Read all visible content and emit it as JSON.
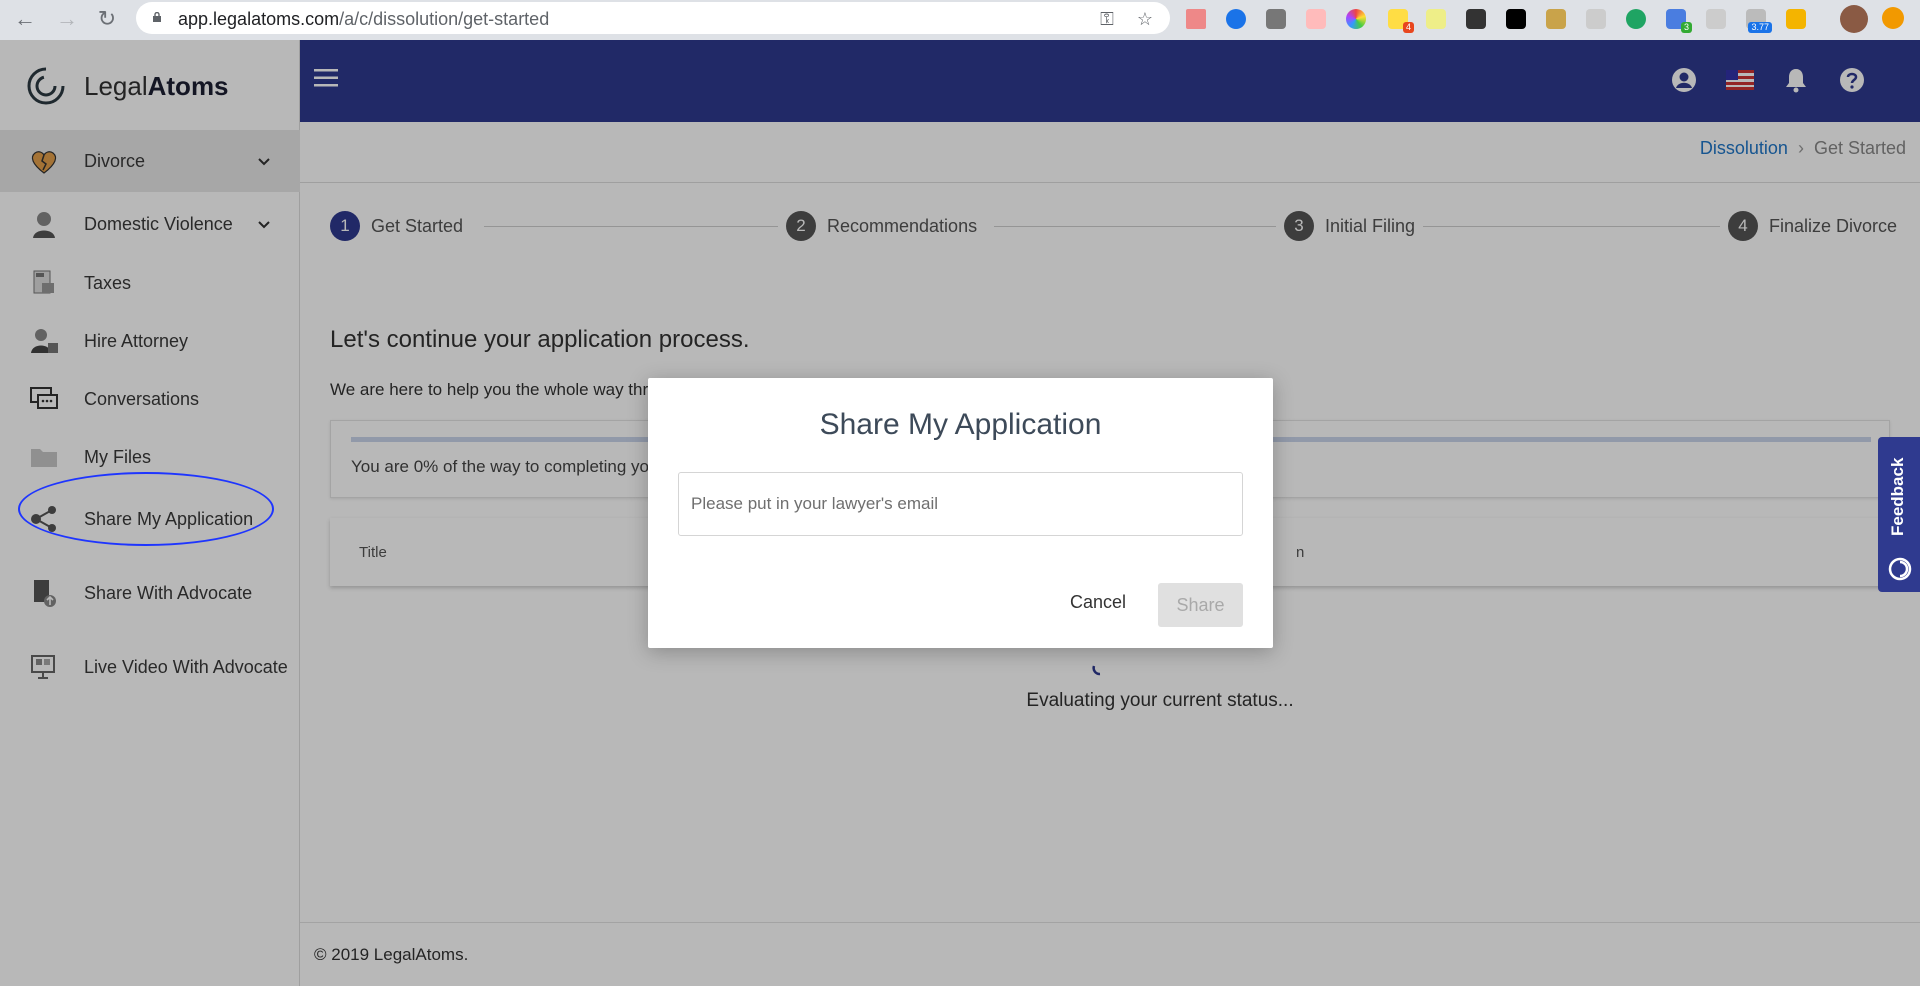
{
  "browser": {
    "url_host": "app.legalatoms.com",
    "url_path": "/a/c/dissolution/get-started",
    "extension_badges": [
      "4",
      "3",
      "3.77"
    ]
  },
  "logo": {
    "light": "Legal",
    "bold": "Atoms"
  },
  "sidebar": {
    "items": [
      {
        "label": "Divorce"
      },
      {
        "label": "Domestic Violence"
      },
      {
        "label": "Taxes"
      },
      {
        "label": "Hire Attorney"
      },
      {
        "label": "Conversations"
      },
      {
        "label": "My Files"
      },
      {
        "label": "Share My Application"
      },
      {
        "label": "Share With Advocate"
      },
      {
        "label": "Live Video With Advocate"
      }
    ]
  },
  "breadcrumb": {
    "parent": "Dissolution",
    "separator": "›",
    "current": "Get Started"
  },
  "steps": [
    {
      "num": "1",
      "label": "Get Started"
    },
    {
      "num": "2",
      "label": "Recommendations"
    },
    {
      "num": "3",
      "label": "Initial Filing"
    },
    {
      "num": "4",
      "label": "Finalize Divorce"
    }
  ],
  "main": {
    "title": "Let's continue your application process.",
    "subtitle": "We are here to help you the whole way thr",
    "progress_text": "You are 0% of the way to completing yo",
    "progress_fraction": 0,
    "table_header_title": "Title",
    "table_header_right": "n",
    "status": "Evaluating your current status..."
  },
  "footer": {
    "copyright": "© 2019 LegalAtoms."
  },
  "feedback": {
    "label": "Feedback"
  },
  "modal": {
    "title": "Share My Application",
    "email_placeholder": "Please put in your lawyer's email",
    "cancel_label": "Cancel",
    "share_label": "Share"
  },
  "colors": {
    "brand": "#2f3a8f",
    "link": "#1f76c8",
    "annotation": "#1e35ff"
  }
}
